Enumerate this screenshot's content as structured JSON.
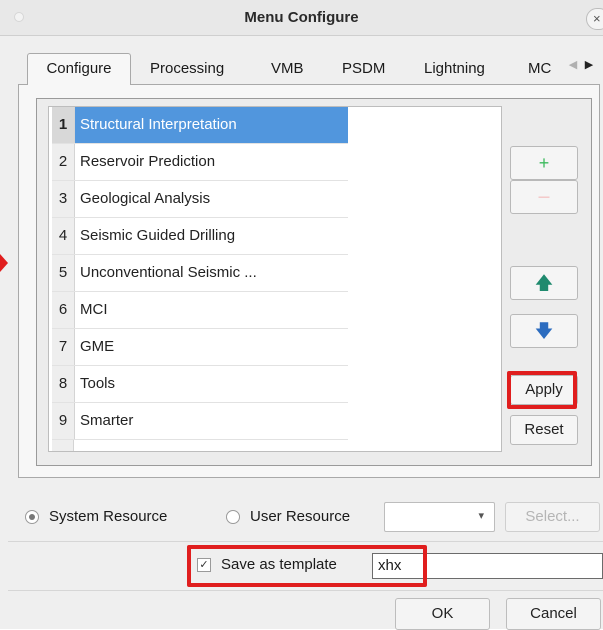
{
  "window": {
    "title": "Menu Configure",
    "close_glyph": "×"
  },
  "tabs": [
    {
      "label": "Configure"
    },
    {
      "label": "Processing"
    },
    {
      "label": "VMB"
    },
    {
      "label": "PSDM"
    },
    {
      "label": "Lightning"
    },
    {
      "label": "MC"
    }
  ],
  "tab_scroll": {
    "left_glyph": "◀",
    "right_glyph": "▶"
  },
  "menu_list": {
    "selected_index": 0,
    "items": [
      {
        "num": "1",
        "label": "Structural Interpretation"
      },
      {
        "num": "2",
        "label": "Reservoir  Prediction"
      },
      {
        "num": "3",
        "label": "Geological Analysis"
      },
      {
        "num": "4",
        "label": "Seismic Guided Drilling"
      },
      {
        "num": "5",
        "label": "Unconventional Seismic ..."
      },
      {
        "num": "6",
        "label": "MCI"
      },
      {
        "num": "7",
        "label": "GME"
      },
      {
        "num": "8",
        "label": "Tools"
      },
      {
        "num": "9",
        "label": "Smarter"
      }
    ]
  },
  "side_buttons": {
    "add_glyph": "+",
    "remove_glyph": "—",
    "up_glyph": "🡅",
    "down_glyph": "🡇",
    "apply_label": "Apply",
    "reset_label": "Reset"
  },
  "resource": {
    "system_label": "System Resource",
    "user_label": "User Resource",
    "selected": "System Resource",
    "dropdown_value": "",
    "dropdown_chevron": "▾",
    "select_label": "Select..."
  },
  "template": {
    "checkbox_mark": "✓",
    "label": "Save as template",
    "checked": true,
    "value": "xhx"
  },
  "footer": {
    "ok_label": "OK",
    "cancel_label": "Cancel"
  },
  "colors": {
    "selection": "#5196dd",
    "highlight": "#e01e1e",
    "add_icon": "#3dbb5e",
    "remove_icon": "#f2a0a0",
    "arrow_up": "#1f8a6e",
    "arrow_down": "#2c6cbf"
  },
  "icons": {
    "add": "plus-icon",
    "remove": "minus-icon",
    "up": "arrow-up-icon",
    "down": "arrow-down-icon",
    "close": "close-icon",
    "callout": "red-arrow-indicator"
  }
}
